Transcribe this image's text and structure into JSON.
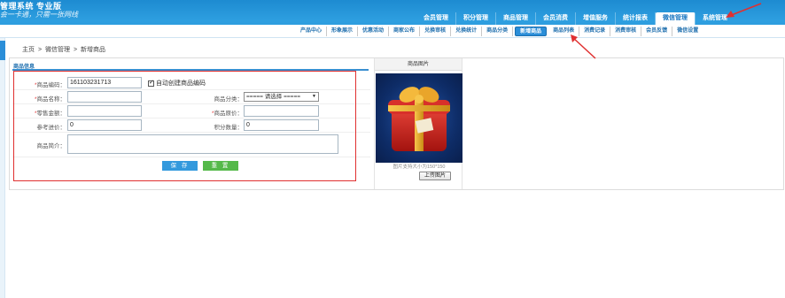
{
  "header": {
    "title": "管理系统 专业版",
    "slogan": "会一卡通，只需一张网线"
  },
  "main_nav": {
    "items": [
      {
        "label": "会员管理",
        "active": false
      },
      {
        "label": "积分管理",
        "active": false
      },
      {
        "label": "商品管理",
        "active": false
      },
      {
        "label": "会员消费",
        "active": false
      },
      {
        "label": "增值服务",
        "active": false
      },
      {
        "label": "统计报表",
        "active": false
      },
      {
        "label": "微信管理",
        "active": true
      },
      {
        "label": "系统管理",
        "active": false
      }
    ]
  },
  "sub_nav": {
    "items": [
      {
        "label": "产品中心",
        "active": false
      },
      {
        "label": "形象展示",
        "active": false
      },
      {
        "label": "优惠活动",
        "active": false
      },
      {
        "label": "商家公布",
        "active": false
      },
      {
        "label": "兑换审核",
        "active": false
      },
      {
        "label": "兑换统计",
        "active": false
      },
      {
        "label": "商品分类",
        "active": false
      },
      {
        "label": "新增商品",
        "active": true
      },
      {
        "label": "商品列表",
        "active": false
      },
      {
        "label": "消费记录",
        "active": false
      },
      {
        "label": "消费审核",
        "active": false
      },
      {
        "label": "会员反馈",
        "active": false
      },
      {
        "label": "微信设置",
        "active": false
      }
    ]
  },
  "breadcrumb": {
    "home": "主页",
    "sep": ">",
    "section": "微信管理",
    "current": "新增商品"
  },
  "form": {
    "section_title": "商品信息",
    "product_code": {
      "label": "商品编码：",
      "value": "161103231713",
      "required": true
    },
    "auto_code": {
      "label": "自动创建商品编码",
      "checked": true
    },
    "product_name": {
      "label": "商品名称：",
      "value": "",
      "required": true
    },
    "category": {
      "label": "商品分类：",
      "selected": "===== 请选择 =====",
      "required": false
    },
    "retail_price": {
      "label": "零售金额：",
      "value": "",
      "required": true
    },
    "original_price": {
      "label": "商品原价：",
      "value": "",
      "required": true
    },
    "reference_price": {
      "label": "参考进价：",
      "value": "0",
      "required": false
    },
    "points": {
      "label": "积分数量：",
      "value": "0",
      "required": false
    },
    "intro": {
      "label": "商品简介：",
      "value": ""
    },
    "save_label": "保 存",
    "reset_label": "重 置"
  },
  "image_panel": {
    "title": "商品图片",
    "hint": "图片支持大小为150*150",
    "upload_label": "上传图片"
  },
  "colors": {
    "header_blue": "#2e9fe0",
    "annotation_red": "#e03030",
    "save_blue": "#3399dd",
    "reset_green": "#55b94a"
  }
}
